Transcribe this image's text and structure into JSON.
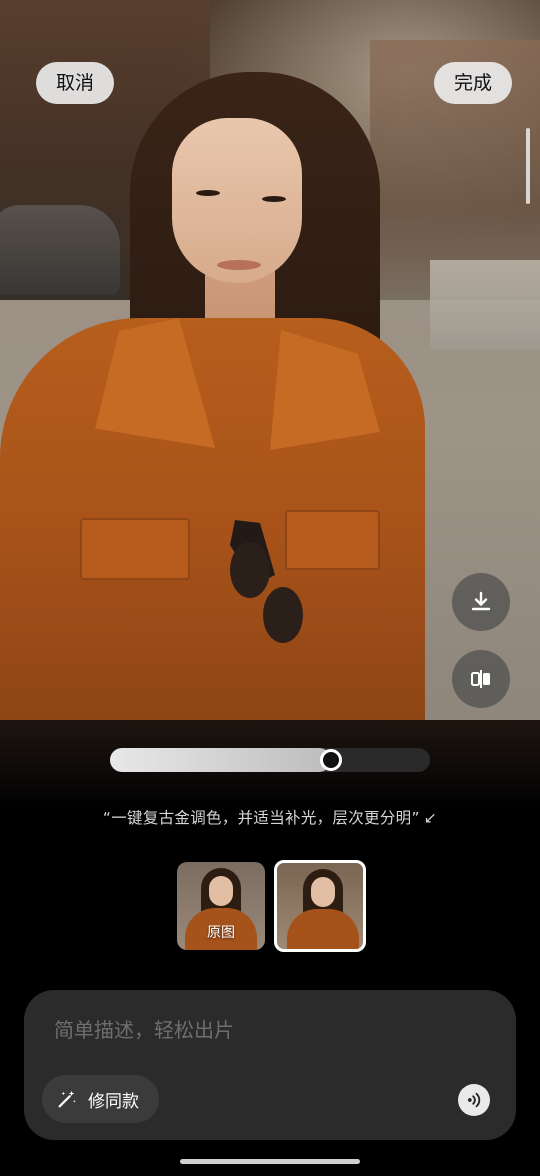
{
  "header": {
    "cancel_label": "取消",
    "done_label": "完成"
  },
  "side_actions": [
    {
      "icon": "download-icon"
    },
    {
      "icon": "compare-icon"
    }
  ],
  "slider": {
    "value": 0.69
  },
  "prompt": {
    "text": "“一键复古金调色，并适当补光，层次更分明”",
    "icon": "arrow-down-left-icon"
  },
  "thumbnails": [
    {
      "label": "原图",
      "selected": false
    },
    {
      "label": "",
      "selected": true
    }
  ],
  "input": {
    "placeholder": "简单描述，轻松出片",
    "chip_label": "修同款",
    "chip_icon": "magic-wand-icon",
    "voice_icon": "voice-icon"
  },
  "colors": {
    "panel_background": "#000000",
    "input_background": "#2b2b2b",
    "button_background": "#ebebeb",
    "shirt": "#b65e1c"
  }
}
